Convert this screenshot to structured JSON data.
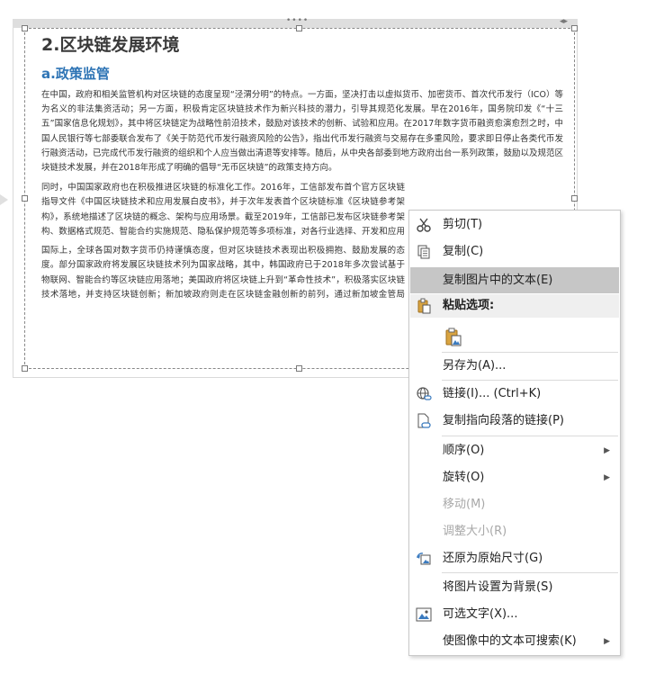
{
  "document": {
    "heading": "2.区块链发展环境",
    "subheading": "a.政策监管",
    "paragraphs": [
      "在中国，政府和相关监管机构对区块链的态度呈现“泾渭分明”的特点。一方面，坚决打击以虚拟货币、加密货币、首次代币发行（ICO）等为名义的非法集资活动；另一方面，积极肯定区块链技术作为新兴科技的潜力，引导其规范化发展。早在2016年，国务院印发《“十三五”国家信息化规划》，其中将区块链定为战略性前沿技术，鼓励对该技术的创新、试验和应用。在2017年数字货币融资愈演愈烈之时，中国人民银行等七部委联合发布了《关于防范代币发行融资风险的公告》，指出代币发行融资与交易存在多重风险，要求即日停止各类代币发行融资活动，已完成代币发行融资的组织和个人应当做出清退等安排等。随后，从中央各部委到地方政府出台一系列政策，鼓励以及规范区块链技术发展，并在2018年形成了明确的倡导“无币区块链”的政策支持方向。",
      "同时，中国国家政府也在积极推进区块链的标准化工作。2016年，工信部发布首个官方区块链指导文件《中国区块链技术和应用发展白皮书》，并于次年发表首个区块链标准《区块链参考架构》，系统地描述了区块链的概念、架构与应用场景。截至2019年，工信部已发布区块链参考架构、数据格式规范、智能合约实施规范、隐私保护规范等多项标准，对各行业选择、开发和应用区块链具有重要的指导和参考价值。",
      "国际上，全球各国对数字货币仍持谨慎态度，但对区块链技术表现出积极拥抱、鼓励发展的态度。部分国家政府将发展区块链技术列为国家战略，其中，韩国政府已于2018年多次尝试基于物联网、智能合约等区块链应用落地；美国政府将区块链上升到“革命性技术”，积极落实区块链技术落地，并支持区块链创新；新加坡政府则走在区块链金融创新的前列，通过新加坡金管局（MAS）发起多项区块链试点项目，研究区块链在支付、贸易融资等方面的应用。"
    ]
  },
  "context_menu": {
    "items": [
      {
        "icon": "scissors-icon",
        "label": "剪切(T)"
      },
      {
        "icon": "copy-icon",
        "label": "复制(C)"
      },
      {
        "icon": "",
        "label": "复制图片中的文本(E)"
      },
      {
        "icon": "paste-icon",
        "label": "粘贴选项:"
      },
      {
        "icon": "paste-picture-icon",
        "label": ""
      },
      {
        "icon": "",
        "label": "另存为(A)..."
      },
      {
        "icon": "globe-link-icon",
        "label": "链接(I)...  (Ctrl+K)"
      },
      {
        "icon": "paragraph-link-icon",
        "label": "复制指向段落的链接(P)"
      },
      {
        "icon": "",
        "label": "顺序(O)"
      },
      {
        "icon": "",
        "label": "旋转(O)"
      },
      {
        "icon": "",
        "label": "移动(M)"
      },
      {
        "icon": "",
        "label": "调整大小(R)"
      },
      {
        "icon": "reset-size-icon",
        "label": "还原为原始尺寸(G)"
      },
      {
        "icon": "",
        "label": "将图片设置为背景(S)"
      },
      {
        "icon": "alt-text-icon",
        "label": "可选文字(X)..."
      },
      {
        "icon": "",
        "label": "使图像中的文本可搜索(K)"
      }
    ]
  },
  "colors": {
    "accent_heading": "#2e74b5",
    "menu_highlight": "#c6c6c6"
  }
}
